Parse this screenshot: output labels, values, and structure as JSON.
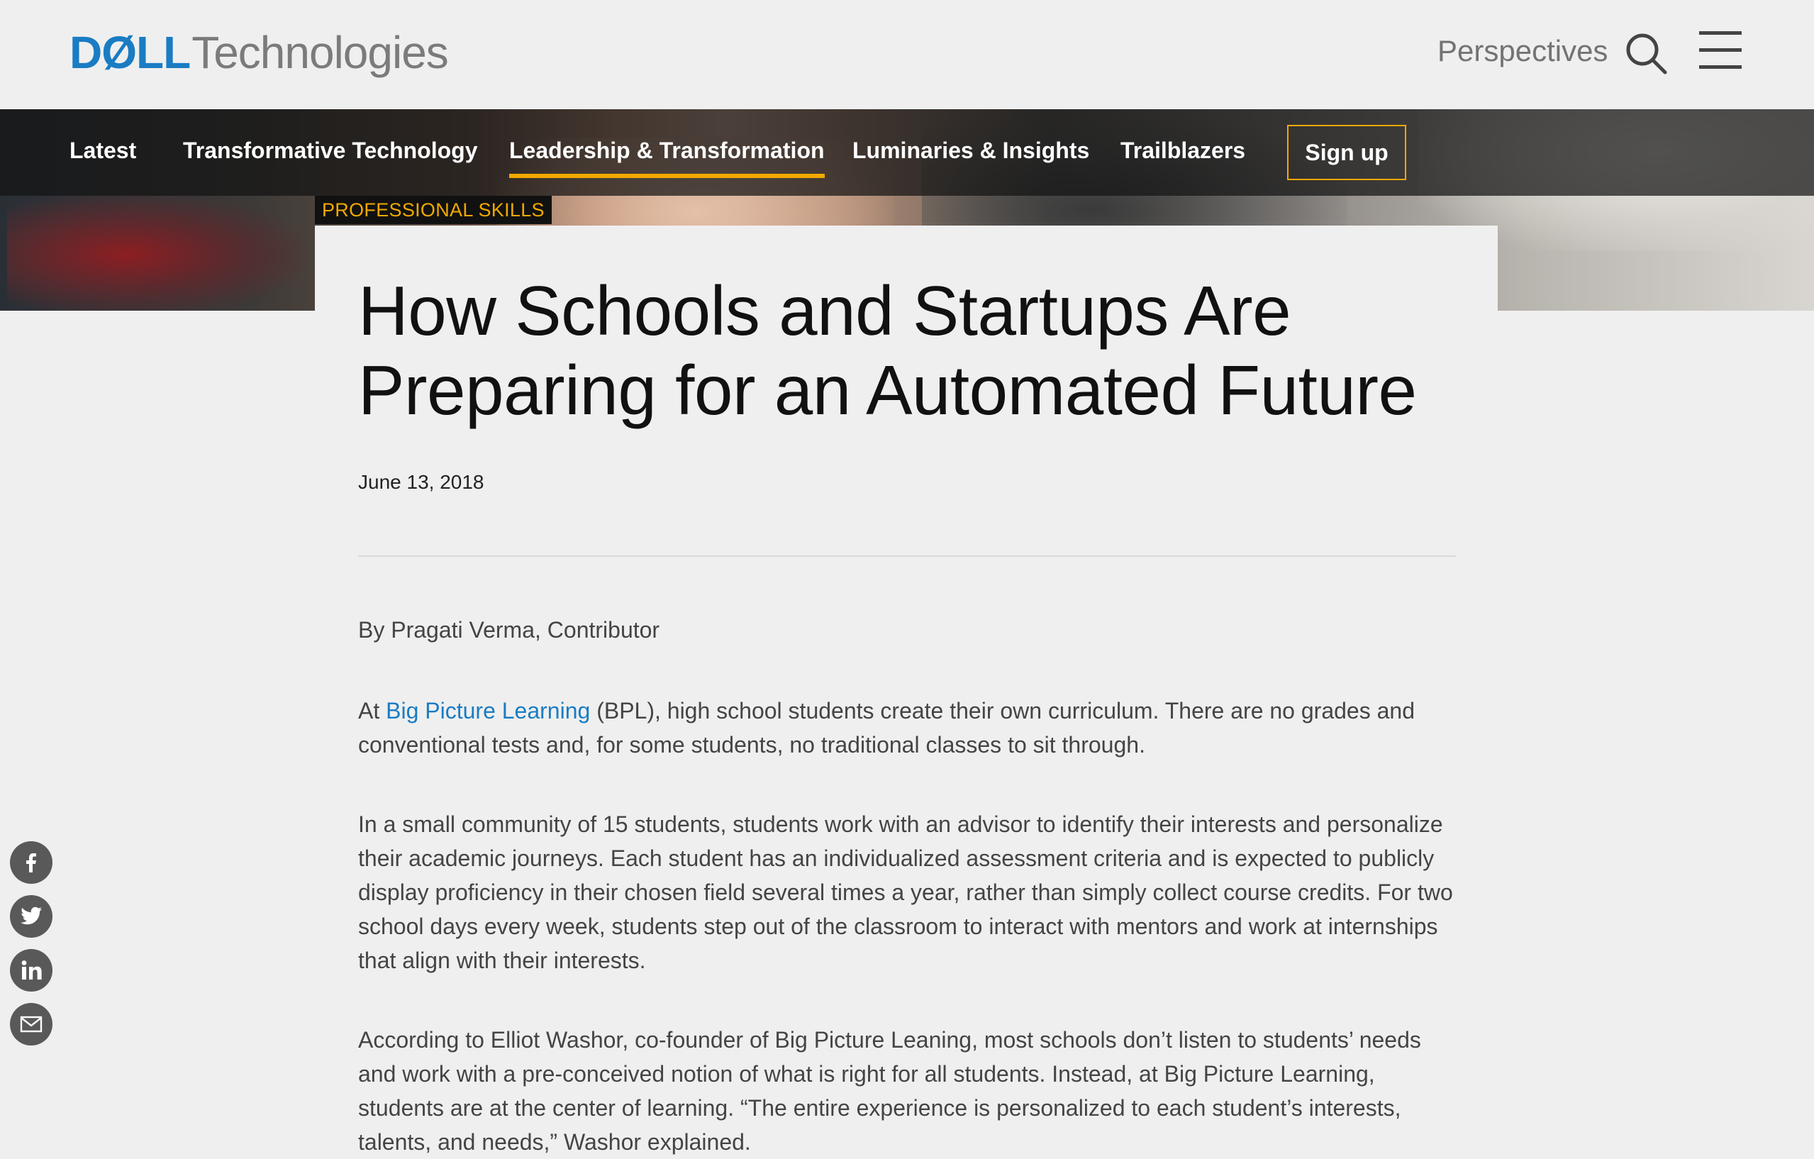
{
  "header": {
    "logo_dell": "DØLL",
    "logo_tech": "Technologies",
    "perspectives": "Perspectives"
  },
  "nav": {
    "items": [
      {
        "label": "Latest"
      },
      {
        "label": "Transformative Technology"
      },
      {
        "label": "Leadership & Transformation"
      },
      {
        "label": "Luminaries & Insights"
      },
      {
        "label": "Trailblazers"
      }
    ],
    "active": "Leadership & Transformation",
    "signup": "Sign up"
  },
  "article": {
    "category": "PROFESSIONAL SKILLS",
    "title": "How Schools and Startups Are Preparing for an Automated Future",
    "date": "June 13, 2018",
    "byline": "By Pragati Verma, Contributor",
    "p1_before": "At ",
    "p1_link": "Big Picture Learning",
    "p1_after": " (BPL), high school students create their own curriculum. There are no grades and conventional tests and, for some students, no traditional classes to sit through.",
    "p2": "In a small community of 15 students, students work with an advisor to identify their interests and personalize their academic journeys. Each student has an individualized assessment criteria and is expected to publicly display proficiency in their chosen field several times a year, rather than simply collect course credits. For two school days every week, students step out of the classroom to interact with mentors and work at internships that align with their interests.",
    "p3": "According to Elliot Washor, co-founder of Big Picture Leaning, most schools don’t listen to students’ needs and work with a pre-conceived notion of what is right for all students. Instead, at Big Picture Learning, students are at the center of learning. “The entire experience is personalized to each student’s interests, talents, and needs,” Washor explained."
  },
  "social": [
    "facebook-icon",
    "twitter-icon",
    "linkedin-icon",
    "email-icon"
  ],
  "colors": {
    "accent": "#f2a900",
    "link": "#1a7cc3",
    "brand": "#1a7cc3"
  }
}
